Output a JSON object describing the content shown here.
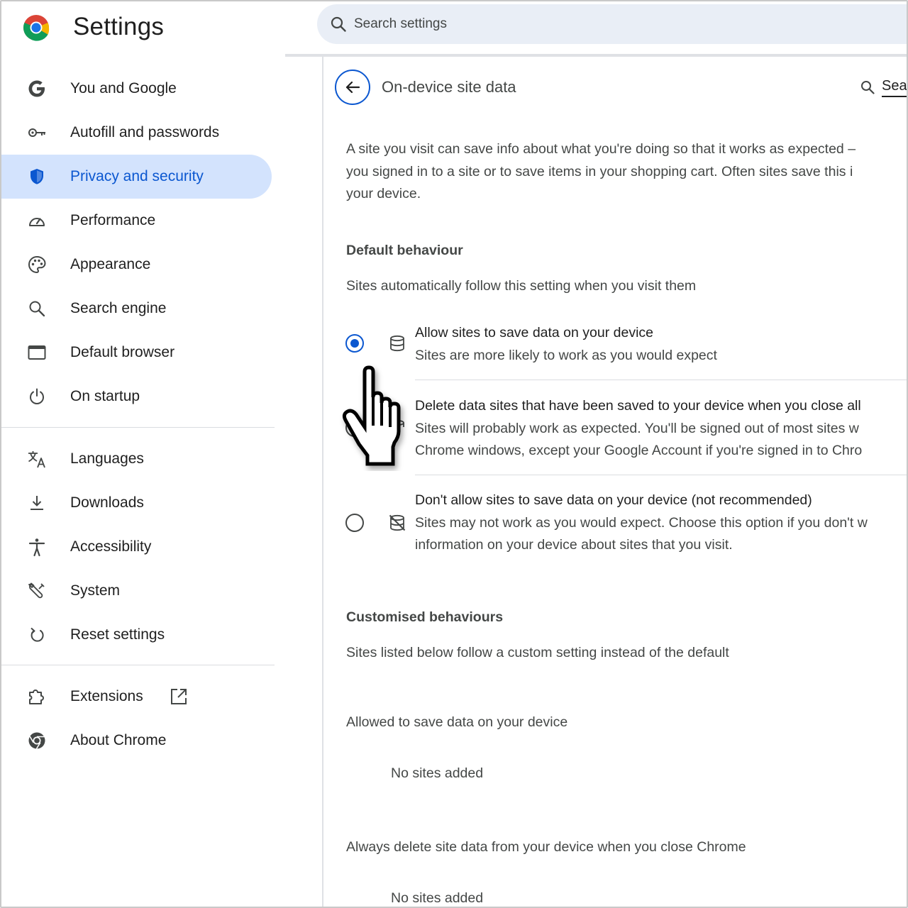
{
  "header": {
    "app_title": "Settings",
    "search_placeholder": "Search settings",
    "logo_icon": "chrome-logo"
  },
  "sidebar": {
    "items": [
      {
        "label": "You and Google",
        "icon": "google-g-icon"
      },
      {
        "label": "Autofill and passwords",
        "icon": "key-icon"
      },
      {
        "label": "Privacy and security",
        "icon": "shield-icon",
        "active": true
      },
      {
        "label": "Performance",
        "icon": "speedometer-icon"
      },
      {
        "label": "Appearance",
        "icon": "palette-icon"
      },
      {
        "label": "Search engine",
        "icon": "search-icon"
      },
      {
        "label": "Default browser",
        "icon": "browser-window-icon"
      },
      {
        "label": "On startup",
        "icon": "power-icon"
      },
      {
        "label": "Languages",
        "icon": "translate-icon"
      },
      {
        "label": "Downloads",
        "icon": "download-icon"
      },
      {
        "label": "Accessibility",
        "icon": "accessibility-icon"
      },
      {
        "label": "System",
        "icon": "wrench-icon"
      },
      {
        "label": "Reset settings",
        "icon": "reset-icon"
      },
      {
        "label": "Extensions",
        "icon": "puzzle-icon"
      },
      {
        "label": "About Chrome",
        "icon": "chrome-icon"
      }
    ]
  },
  "main": {
    "title": "On-device site data",
    "search_label": "Sea",
    "description": [
      "A site you visit can save info about what you're doing so that it works as expected –",
      "you signed in to a site or to save items in your shopping cart. Often sites save this i",
      "your device."
    ],
    "default_behaviour": {
      "heading": "Default behaviour",
      "subtitle": "Sites automatically follow this setting when you visit them",
      "options": [
        {
          "title": "Allow sites to save data on your device",
          "lines": [
            "Sites are more likely to work as you would expect"
          ],
          "icon": "database-icon",
          "checked": true
        },
        {
          "title": "Delete data sites that have been saved to your device when you close all",
          "lines": [
            "Sites will probably work as expected. You'll be signed out of most sites w",
            "Chrome windows, except your Google Account if you're signed in to Chro"
          ],
          "icon": "database-clock-icon",
          "checked": false
        },
        {
          "title": "Don't allow sites to save data on your device (not recommended)",
          "lines": [
            "Sites may not work as you would expect. Choose this option if you don't w",
            "information on your device about sites that you visit."
          ],
          "icon": "database-off-icon",
          "checked": false
        }
      ]
    },
    "customised_behaviours": {
      "heading": "Customised behaviours",
      "subtitle": "Sites listed below follow a custom setting instead of the default",
      "allowed": {
        "title": "Allowed to save data on your device",
        "empty": "No sites added"
      },
      "always_delete": {
        "title": "Always delete site data from your device when you close Chrome",
        "empty": "No sites added"
      }
    }
  },
  "colors": {
    "accent": "#0b57d0",
    "active_bg": "#d3e3fd",
    "search_bg": "#e9eef6"
  }
}
